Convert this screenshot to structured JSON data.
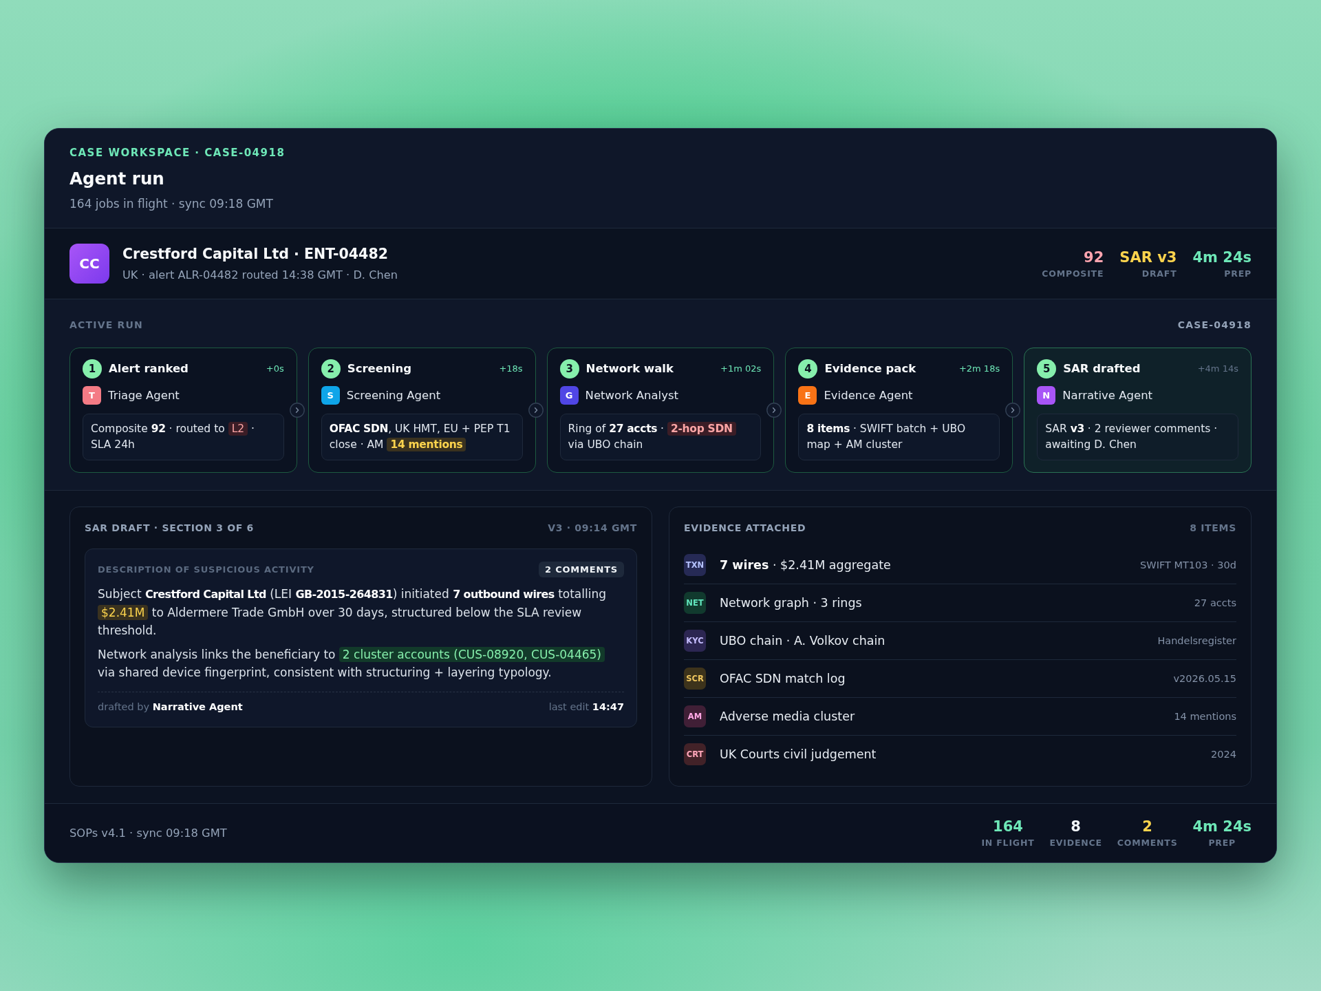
{
  "header": {
    "eyebrow": "CASE WORKSPACE · CASE-04918",
    "title": "Agent run",
    "subtitle": "164 jobs in flight · sync 09:18 GMT"
  },
  "entity": {
    "initials": "CC",
    "name": "Crestford Capital Ltd · ENT-04482",
    "details": "UK · alert ALR-04482 routed 14:38 GMT · D. Chen",
    "stats": [
      {
        "value": "92",
        "label": "COMPOSITE",
        "color": "#fda4af"
      },
      {
        "value": "SAR v3",
        "label": "DRAFT",
        "color": "#fcd34d"
      },
      {
        "value": "4m 24s",
        "label": "PREP",
        "color": "#6ee7b7"
      }
    ]
  },
  "active_run": {
    "title": "ACTIVE RUN",
    "case_id": "CASE-04918",
    "steps": [
      {
        "number": "1",
        "title": "Alert ranked",
        "elapsed": "+0s",
        "current": false,
        "agent": {
          "initial": "T",
          "name": "Triage Agent",
          "color": "#f47b85"
        },
        "summary": [
          {
            "kind": "text",
            "text": "Composite **92** · routed to "
          },
          {
            "kind": "alert",
            "text": "L2"
          },
          {
            "kind": "text",
            "text": " · SLA 24h"
          }
        ]
      },
      {
        "number": "2",
        "title": "Screening",
        "elapsed": "+18s",
        "current": false,
        "agent": {
          "initial": "S",
          "name": "Screening Agent",
          "color": "#0ea5e9"
        },
        "summary": [
          {
            "kind": "text",
            "text": "**OFAC SDN**, UK HMT, EU + PEP T1 close · AM "
          },
          {
            "kind": "caution",
            "text": "**14 mentions**"
          }
        ]
      },
      {
        "number": "3",
        "title": "Network walk",
        "elapsed": "+1m 02s",
        "current": false,
        "agent": {
          "initial": "G",
          "name": "Network Analyst",
          "color": "#5046e5"
        },
        "summary": [
          {
            "kind": "text",
            "text": "Ring of **27 accts** · "
          },
          {
            "kind": "alert",
            "text": "**2-hop SDN**"
          },
          {
            "kind": "text",
            "text": " via UBO chain"
          }
        ]
      },
      {
        "number": "4",
        "title": "Evidence pack",
        "elapsed": "+2m 18s",
        "current": false,
        "agent": {
          "initial": "E",
          "name": "Evidence Agent",
          "color": "#f97316"
        },
        "summary": [
          {
            "kind": "text",
            "text": "**8 items** · SWIFT batch + UBO map + AM cluster"
          }
        ]
      },
      {
        "number": "5",
        "title": "SAR drafted",
        "elapsed": "+4m 14s",
        "current": true,
        "agent": {
          "initial": "N",
          "name": "Narrative Agent",
          "color": "#a855f7"
        },
        "summary": [
          {
            "kind": "text",
            "text": "SAR **v3** · 2 reviewer comments · awaiting D. Chen"
          }
        ]
      }
    ]
  },
  "sar_draft": {
    "title": "SAR DRAFT · SECTION 3 OF 6",
    "version": "V3 · 09:14 GMT",
    "section": {
      "heading": "DESCRIPTION OF SUSPICIOUS ACTIVITY",
      "comments": "2 COMMENTS",
      "paragraphs": [
        [
          {
            "kind": "text",
            "text": "Subject **Crestford Capital Ltd** (LEI **GB-2015-264831**) initiated **7 outbound wires** totalling "
          },
          {
            "kind": "caution",
            "text": "$2.41M"
          },
          {
            "kind": "text",
            "text": " to Aldermere Trade GmbH over 30 days, structured below the SLA review threshold."
          }
        ],
        [
          {
            "kind": "text",
            "text": "Network analysis links the beneficiary to "
          },
          {
            "kind": "positive",
            "text": "2 cluster accounts (CUS-08920, CUS-04465)"
          },
          {
            "kind": "text",
            "text": " via shared device fingerprint, consistent with structuring + layering typology."
          }
        ]
      ],
      "author_line": "drafted by **Narrative Agent**",
      "edit_line": "last edit **14:47**"
    }
  },
  "evidence": {
    "title": "EVIDENCE ATTACHED",
    "count": "8 ITEMS",
    "items": [
      {
        "tag": "TXN",
        "color": "#262a55",
        "title": "**7 wires** · $2.41M aggregate",
        "meta": "SWIFT MT103 · 30d"
      },
      {
        "tag": "NET",
        "color": "#113a2e",
        "title": "Network graph · 3 rings",
        "meta": "27 accts"
      },
      {
        "tag": "KYC",
        "color": "#2c2652",
        "title": "UBO chain · A. Volkov chain",
        "meta": "Handelsregister"
      },
      {
        "tag": "SCR",
        "color": "#3d331b",
        "title": "OFAC SDN match log",
        "meta": "v2026.05.15"
      },
      {
        "tag": "AM",
        "color": "#401f36",
        "title": "Adverse media cluster",
        "meta": "14 mentions"
      },
      {
        "tag": "CRT",
        "color": "#422228",
        "title": "UK Courts civil judgement",
        "meta": "2024"
      }
    ]
  },
  "footer": {
    "text": "SOPs v4.1 · sync 09:18 GMT",
    "stats": [
      {
        "value": "164",
        "label": "IN FLIGHT",
        "color": "#6ee7b7"
      },
      {
        "value": "8",
        "label": "EVIDENCE",
        "color": "#f1f5f9"
      },
      {
        "value": "2",
        "label": "COMMENTS",
        "color": "#fcd34d"
      },
      {
        "value": "4m 24s",
        "label": "PREP",
        "color": "#6ee7b7"
      }
    ]
  }
}
